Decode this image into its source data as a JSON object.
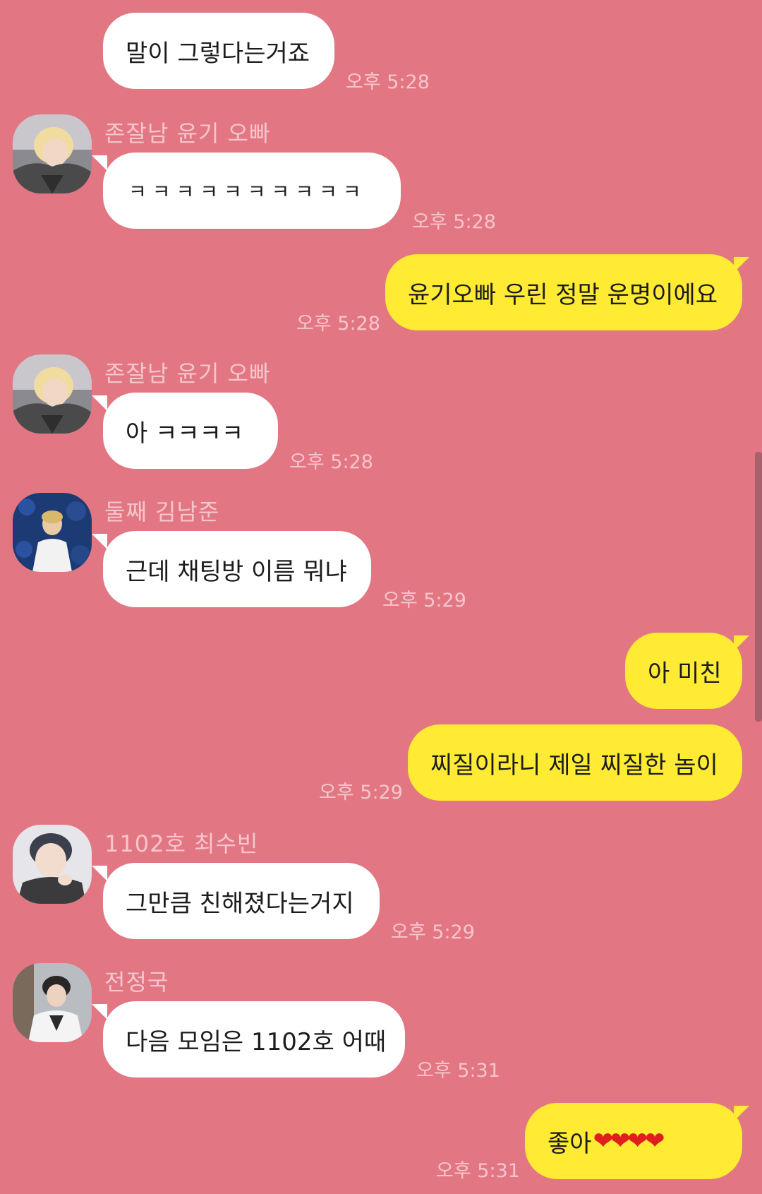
{
  "messages": [
    {
      "dir": "in",
      "text": "말이 그렇다는거죠",
      "time": "오후 5:28"
    },
    {
      "dir": "in",
      "sender": "존잘남 윤기 오빠",
      "avatar": "suga-avatar",
      "text": "ㅋㅋㅋㅋㅋㅋㅋㅋㅋㅋ",
      "time": "오후 5:28"
    },
    {
      "dir": "out",
      "text": "윤기오빠 우린 정말 운명이에요",
      "time": "오후 5:28"
    },
    {
      "dir": "in",
      "sender": "존잘남 윤기 오빠",
      "avatar": "suga-avatar",
      "text": "아 ㅋㅋㅋㅋ",
      "time": "오후 5:28"
    },
    {
      "dir": "in",
      "sender": "둘째 김남준",
      "avatar": "namjoon-avatar",
      "text": "근데 채팅방 이름 뭐냐",
      "time": "오후 5:29"
    },
    {
      "dir": "out",
      "text": "아 미친",
      "time": ""
    },
    {
      "dir": "out",
      "text": "찌질이라니 제일 찌질한 놈이",
      "time": "오후 5:29"
    },
    {
      "dir": "in",
      "sender": "1102호 최수빈",
      "avatar": "soobin-avatar",
      "text": "그만큼 친해졌다는거지",
      "time": "오후 5:29"
    },
    {
      "dir": "in",
      "sender": "전정국",
      "avatar": "jungkook-avatar",
      "text": "다음 모임은 1102호 어때",
      "time": "오후 5:31"
    },
    {
      "dir": "out",
      "text": "좋아",
      "emoji": "❤❤❤❤",
      "time": "오후 5:31"
    }
  ],
  "colors": {
    "background": "#e27783",
    "incoming_bubble": "#ffffff",
    "outgoing_bubble": "#ffeb33",
    "meta_text": "#f6c6cc"
  }
}
